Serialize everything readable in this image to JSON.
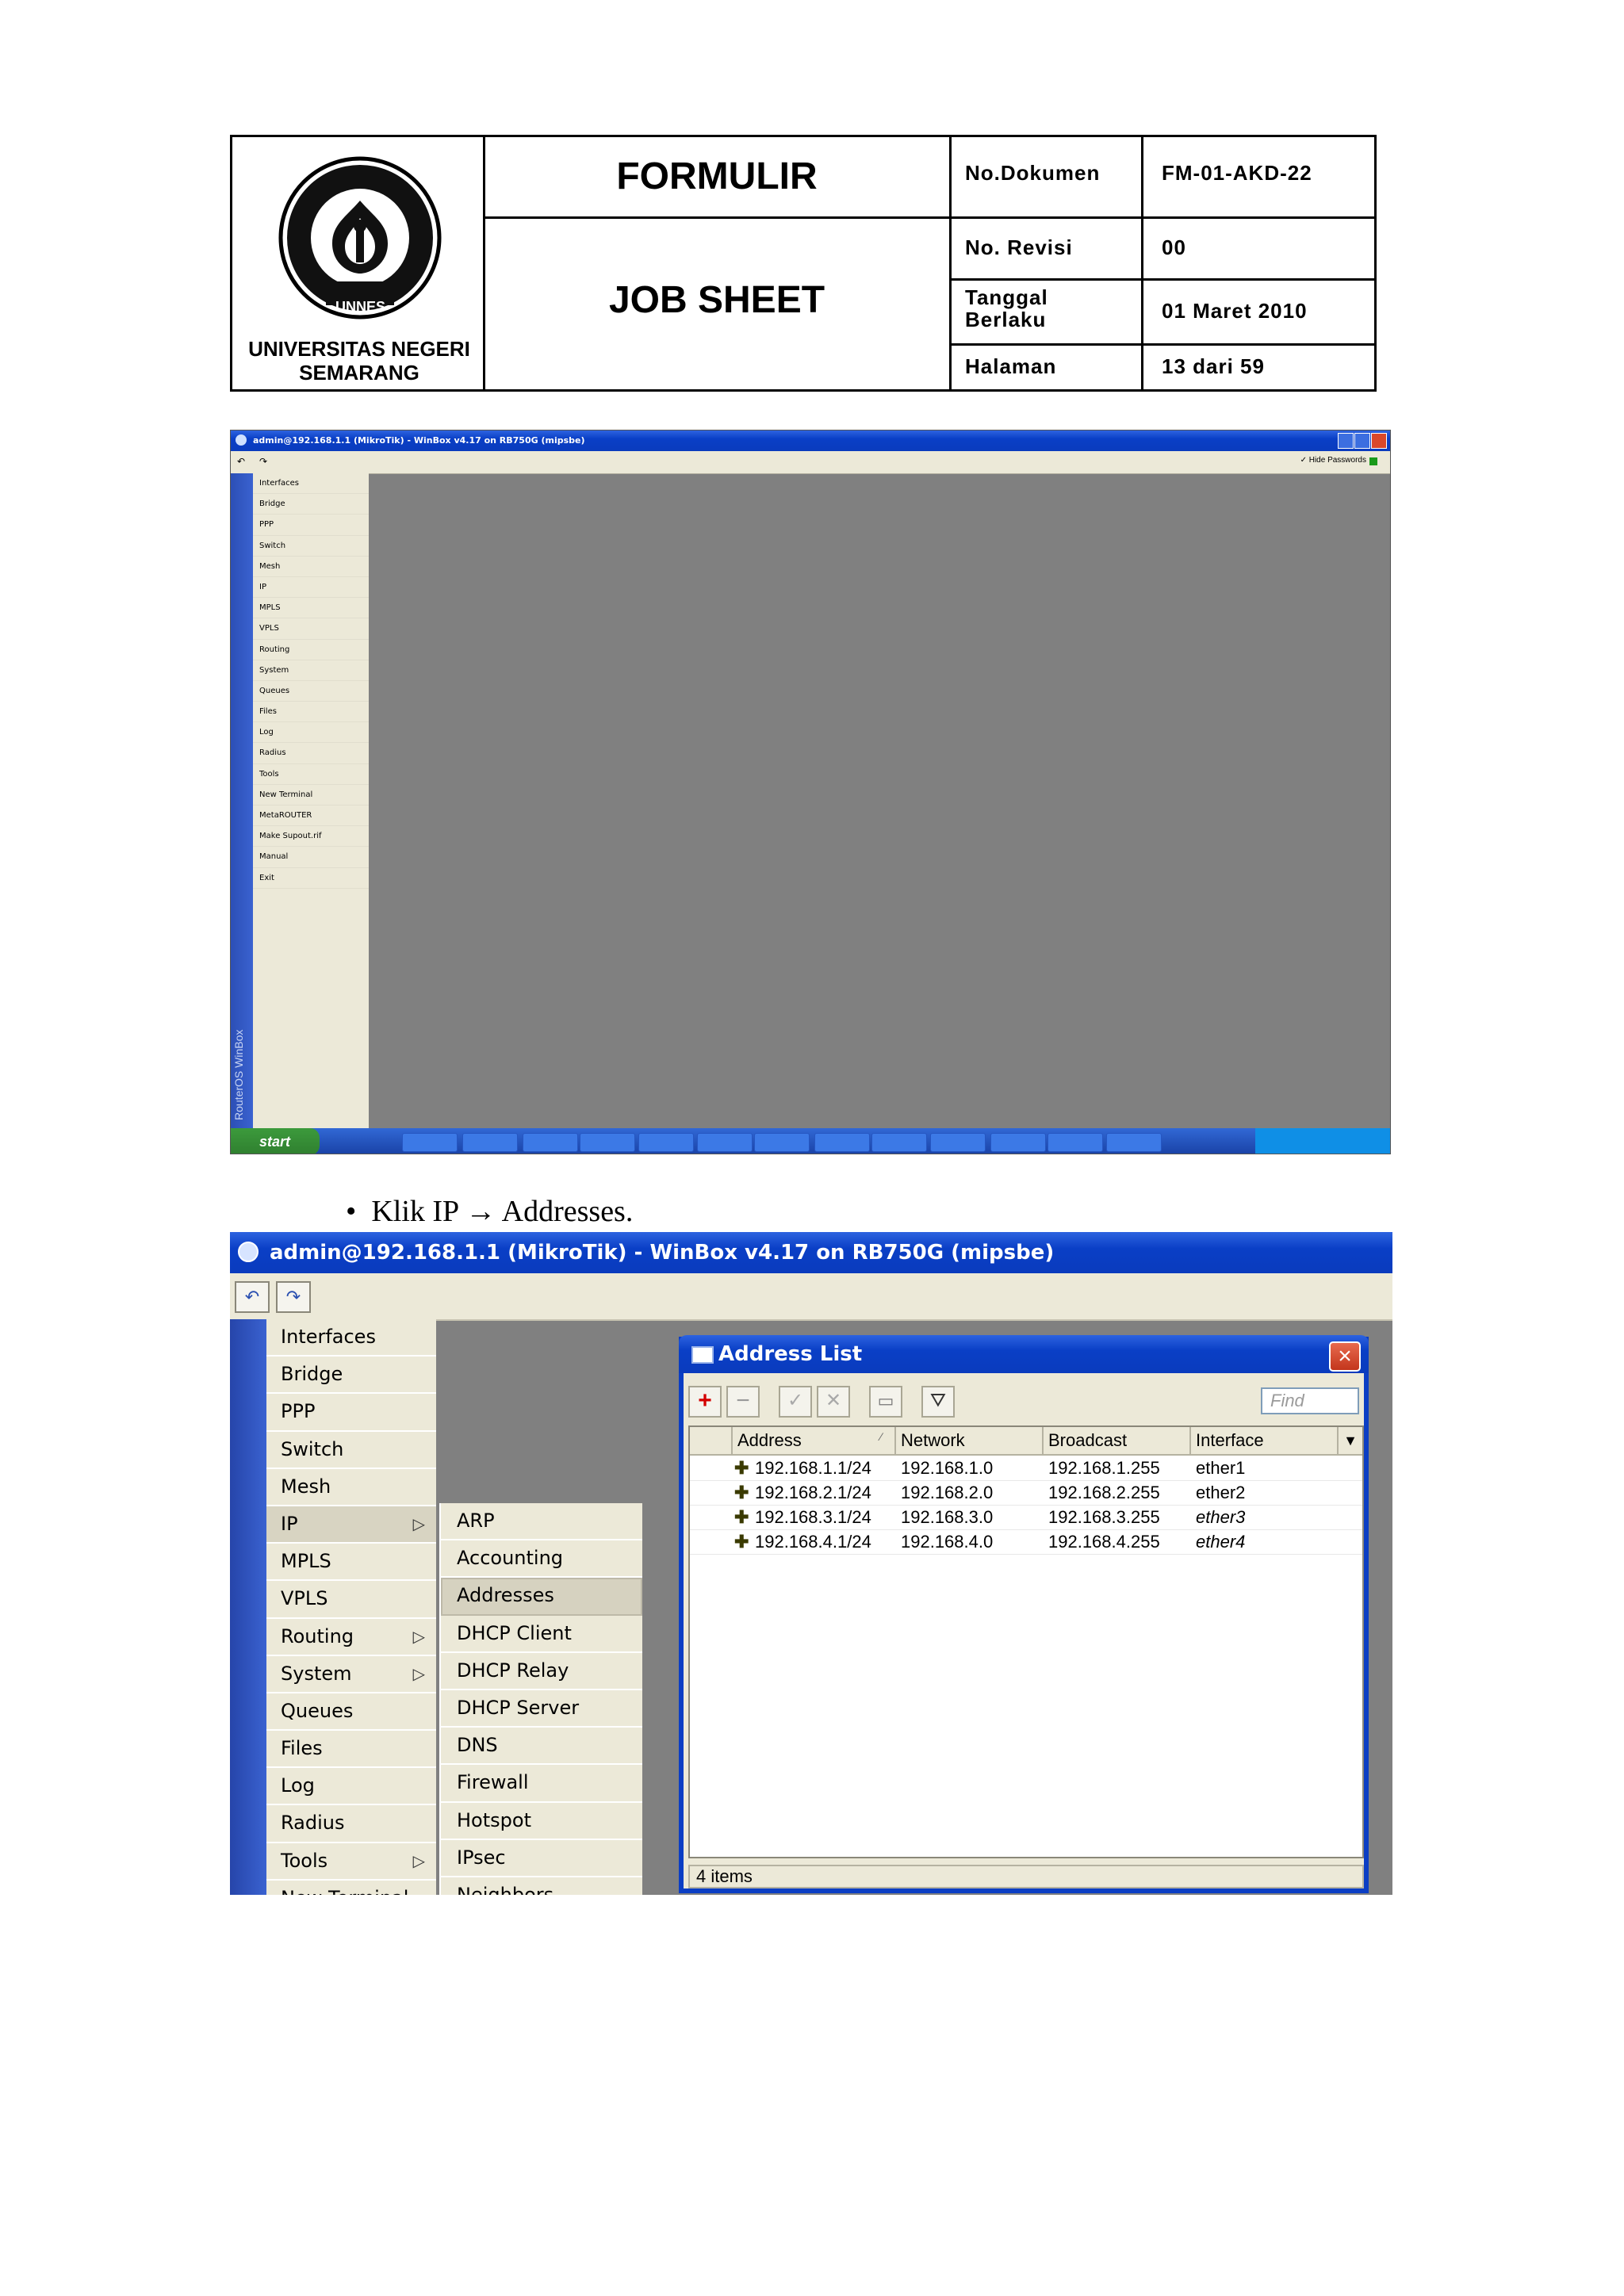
{
  "header": {
    "university": "UNIVERSITAS NEGERI SEMARANG",
    "logo_text": "UNNES",
    "form_title": "FORMULIR",
    "sheet_title": "JOB SHEET",
    "rows": [
      {
        "label": "No.Dokumen",
        "value": "FM-01-AKD-22"
      },
      {
        "label": "No. Revisi",
        "value": "00"
      },
      {
        "label": "Tanggal Berlaku",
        "value": "01 Maret 2010"
      },
      {
        "label": "Halaman",
        "value": "13 dari 59"
      }
    ]
  },
  "screenshot1": {
    "title": "admin@192.168.1.1 (MikroTik) - WinBox v4.17 on RB750G (mipsbe)",
    "hide_passwords": "Hide Passwords",
    "side_label": "RouterOS WinBox",
    "start_label": "start",
    "menu": [
      "Interfaces",
      "Bridge",
      "PPP",
      "Switch",
      "Mesh",
      "IP",
      "MPLS",
      "VPLS",
      "Routing",
      "System",
      "Queues",
      "Files",
      "Log",
      "Radius",
      "Tools",
      "New Terminal",
      "MetaROUTER",
      "Make Supout.rif",
      "Manual",
      "Exit"
    ]
  },
  "instruction": "Klik IP → Addresses.",
  "screenshot2": {
    "title": "admin@192.168.1.1 (MikroTik) - WinBox v4.17 on RB750G (mipsbe)",
    "menu": [
      {
        "label": "Interfaces",
        "arrow": false
      },
      {
        "label": "Bridge",
        "arrow": false
      },
      {
        "label": "PPP",
        "arrow": false
      },
      {
        "label": "Switch",
        "arrow": false
      },
      {
        "label": "Mesh",
        "arrow": false
      },
      {
        "label": "IP",
        "arrow": true
      },
      {
        "label": "MPLS",
        "arrow": false
      },
      {
        "label": "VPLS",
        "arrow": false
      },
      {
        "label": "Routing",
        "arrow": true
      },
      {
        "label": "System",
        "arrow": true
      },
      {
        "label": "Queues",
        "arrow": false
      },
      {
        "label": "Files",
        "arrow": false
      },
      {
        "label": "Log",
        "arrow": false
      },
      {
        "label": "Radius",
        "arrow": false
      },
      {
        "label": "Tools",
        "arrow": true
      },
      {
        "label": "New Terminal",
        "arrow": false
      }
    ],
    "submenu": [
      "ARP",
      "Accounting",
      "Addresses",
      "DHCP Client",
      "DHCP Relay",
      "DHCP Server",
      "DNS",
      "Firewall",
      "Hotspot",
      "IPsec",
      "Neighbors"
    ],
    "address_list": {
      "title": "Address List",
      "find_placeholder": "Find",
      "columns": [
        "Address",
        "Network",
        "Broadcast",
        "Interface"
      ],
      "rows": [
        {
          "address": "192.168.1.1/24",
          "network": "192.168.1.0",
          "broadcast": "192.168.1.255",
          "interface": "ether1",
          "italic": false
        },
        {
          "address": "192.168.2.1/24",
          "network": "192.168.2.0",
          "broadcast": "192.168.2.255",
          "interface": "ether2",
          "italic": false
        },
        {
          "address": "192.168.3.1/24",
          "network": "192.168.3.0",
          "broadcast": "192.168.3.255",
          "interface": "ether3",
          "italic": true
        },
        {
          "address": "192.168.4.1/24",
          "network": "192.168.4.0",
          "broadcast": "192.168.4.255",
          "interface": "ether4",
          "italic": true
        }
      ],
      "status": "4 items"
    }
  },
  "colors": {
    "titlebar": "#0a3fc6",
    "winbox_bg": "#808080",
    "panel": "#ece9d8",
    "add_red": "#d40000"
  }
}
